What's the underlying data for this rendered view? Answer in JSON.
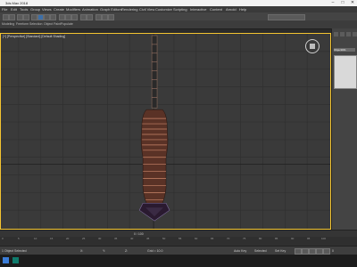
{
  "window": {
    "title": "3ds Max 2018"
  },
  "menu": [
    "File",
    "Edit",
    "Tools",
    "Group",
    "Views",
    "Create",
    "Modifiers",
    "Animation",
    "Graph Editors",
    "Rendering",
    "Civil View",
    "Customize",
    "Scripting",
    "Interactive",
    "Content",
    "Arnold",
    "Help"
  ],
  "ribbon_tabs": [
    "Modeling",
    "Freeform",
    "Selection",
    "Object Paint",
    "Populate"
  ],
  "viewport": {
    "label": "[+] [Perspective] [Standard] [Default Shading]"
  },
  "command_panel": {
    "object_name": "Object001"
  },
  "timeline": {
    "frame_indicator": "0 / 100",
    "ticks": [
      "0",
      "5",
      "10",
      "15",
      "20",
      "25",
      "30",
      "35",
      "40",
      "45",
      "50",
      "55",
      "60",
      "65",
      "70",
      "75",
      "80",
      "85",
      "90",
      "95",
      "100"
    ]
  },
  "status": {
    "selected": "1 Object Selected",
    "x_field": "X:",
    "y_field": "Y:",
    "z_field": "Z:",
    "grid": "Grid = 10.0",
    "auto_key": "Auto Key",
    "set_key": "Set Key",
    "key_mode": "Selected",
    "frame": "0"
  },
  "colors": {
    "viewport_border": "#f4c430",
    "tower_base": "#6b3a2a"
  }
}
